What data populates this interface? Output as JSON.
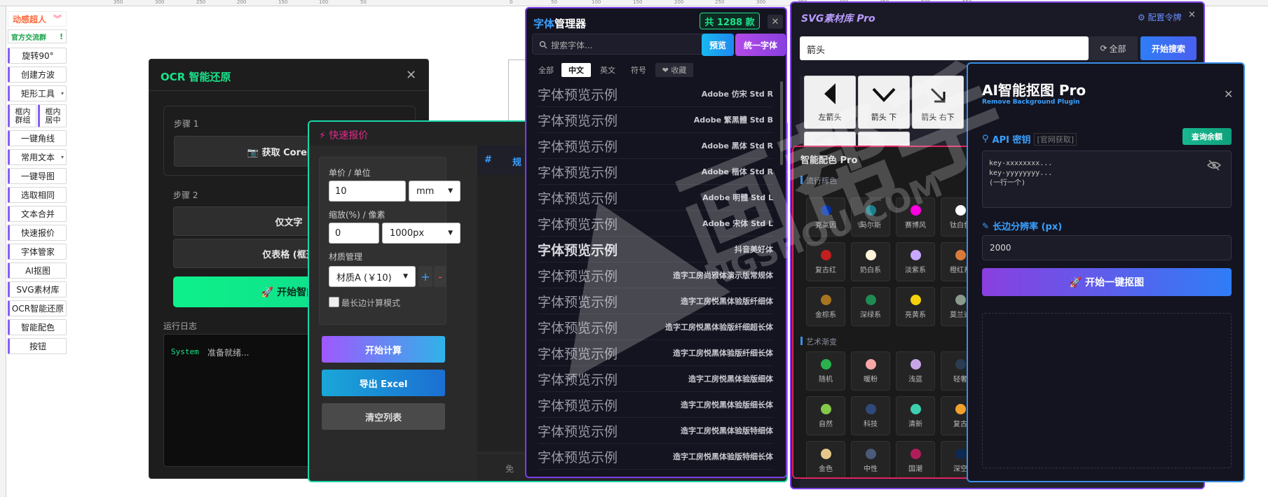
{
  "ruler": {
    "ticks": [
      "350",
      "300",
      "250",
      "200",
      "150",
      "100",
      "50",
      "0",
      "50",
      "100",
      "150",
      "200",
      "250",
      "300",
      "350",
      "400",
      "450",
      "500",
      "550"
    ]
  },
  "toolbar": {
    "brand": "动感超人",
    "brand_icon": "double-chevron-down-icon",
    "group": "官方交流群",
    "group_mark": "!",
    "items": [
      "旋转90°",
      "创建方波",
      "矩形工具",
      "一键角线",
      "常用文本",
      "一键导图",
      "选取相同",
      "文本合并",
      "快速报价",
      "字体管家",
      "AI抠图",
      "SVG素材库",
      "OCR智能还原",
      "智能配色",
      "按钮"
    ],
    "split_a": "框内群组",
    "split_b": "框内居中"
  },
  "ocr": {
    "title": "OCR 智能还原",
    "close": "✕",
    "step1": "步骤 1",
    "fetch_btn": "📷 获取 CorelDRA",
    "step2": "步骤 2",
    "text_only": "仅文字",
    "table_only": "仅表格 (框选",
    "start_btn": "🚀 开始智能",
    "log_title": "运行日志",
    "log_src": "System",
    "log_msg": "准备就绪..."
  },
  "quote": {
    "title": "⚡ 快速报价",
    "unit_label": "单价 / 单位",
    "unit_value": "10",
    "unit_sel": "mm",
    "scale_label": "缩放(%) / 像素",
    "scale_value": "0",
    "px_sel": "1000px",
    "mat_label": "材质管理",
    "mat_sel": "材质A (￥10)",
    "plus": "+",
    "minus": "-",
    "long_edge": "最长边计算模式",
    "calc_btn": "开始计算",
    "export_btn": "导出 Excel",
    "clear_btn": "清空列表",
    "col_hash": "#",
    "col_spec": "规",
    "footer": "免"
  },
  "font_manager": {
    "title_a": "字体",
    "title_b": "管理器",
    "count": "共 1288 款",
    "close": "✕",
    "search_placeholder": "搜索字体...",
    "preview_btn": "预览",
    "unify_btn": "统一字体",
    "tabs": [
      "全部",
      "中文",
      "英文",
      "符号",
      "❤ 收藏"
    ],
    "active_tab": "中文",
    "rows": [
      {
        "preview": "字体预览示例",
        "name": "Adobe 仿宋 Std R"
      },
      {
        "preview": "字体预览示例",
        "name": "Adobe 繁黑體 Std B"
      },
      {
        "preview": "字体预览示例",
        "name": "Adobe 黑体 Std R"
      },
      {
        "preview": "字体预览示例",
        "name": "Adobe 楷体 Std R"
      },
      {
        "preview": "字体预览示例",
        "name": "Adobe 明體 Std L"
      },
      {
        "preview": "字体预览示例",
        "name": "Adobe 宋体 Std L"
      },
      {
        "preview": "字体预览示例",
        "name": "抖音美好体"
      },
      {
        "preview": "字体预览示例",
        "name": "造字工房尚雅体演示版常规体"
      },
      {
        "preview": "字体预览示例",
        "name": "造字工房悦黑体验版纤细体"
      },
      {
        "preview": "字体预览示例",
        "name": "造字工房悦黑体验版纤细超长体"
      },
      {
        "preview": "字体预览示例",
        "name": "造字工房悦黑体验版纤细长体"
      },
      {
        "preview": "字体预览示例",
        "name": "造字工房悦黑体验版细体"
      },
      {
        "preview": "字体预览示例",
        "name": "造字工房悦黑体验版细长体"
      },
      {
        "preview": "字体预览示例",
        "name": "造字工房悦黑体验版特细体"
      },
      {
        "preview": "字体预览示例",
        "name": "造字工房悦黑体验版特细长体"
      }
    ]
  },
  "svg_lib": {
    "title": "SVG素材库 Pro",
    "config": "⚙ 配置令牌",
    "close": "✕",
    "search_value": "箭头",
    "scope": "全部",
    "search_btn": "开始搜索",
    "icons": [
      {
        "label": "左箭头",
        "icon": "arrow-left-icon"
      },
      {
        "label": "箭头 下",
        "icon": "chevron-down-icon"
      },
      {
        "label": "箭头 右下",
        "icon": "arrow-down-right-icon"
      }
    ]
  },
  "color": {
    "title": "智能配色 Pro",
    "sec1": "流行辉色",
    "sec2": "艺术渐变",
    "swatches1": [
      {
        "name": "克莱因",
        "color": "#002fa7"
      },
      {
        "name": "马尔斯",
        "color": "#1a7f8a"
      },
      {
        "name": "赛博风",
        "color": "#ff00e0"
      },
      {
        "name": "钛白色",
        "color": "#ffffff"
      },
      {
        "name": "复古红",
        "color": "#c0201e"
      },
      {
        "name": "奶白系",
        "color": "#fff3d9"
      },
      {
        "name": "淡紫系",
        "color": "#c9a9ff"
      },
      {
        "name": "橙红系",
        "color": "#d97b3a"
      },
      {
        "name": "金棕系",
        "color": "#a8741f"
      },
      {
        "name": "深绿系",
        "color": "#1f8c52"
      },
      {
        "name": "亮黄系",
        "color": "#f4d10b"
      },
      {
        "name": "莫兰迪",
        "color": "#8a9a8c"
      }
    ],
    "swatches2": [
      {
        "name": "随机",
        "color": "#2bb24c"
      },
      {
        "name": "暖粉",
        "color": "#f9a6a6"
      },
      {
        "name": "浅蓝",
        "color": "#c8a6e6"
      },
      {
        "name": "轻奢",
        "color": "#2a3b52"
      },
      {
        "name": "自然",
        "color": "#86c94a"
      },
      {
        "name": "科技",
        "color": "#2f4a7a"
      },
      {
        "name": "清新",
        "color": "#3fcfb0"
      },
      {
        "name": "复古",
        "color": "#f2a12b"
      },
      {
        "name": "金色",
        "color": "#e6c98a"
      },
      {
        "name": "中性",
        "color": "#4a5a7a"
      },
      {
        "name": "国潮",
        "color": "#b01e5a"
      },
      {
        "name": "深空",
        "color": "#0d2a55"
      }
    ]
  },
  "ai_cutout": {
    "title": "AI智能抠图 Pro",
    "subtitle": "Remove Background Plugin",
    "close": "✕",
    "api_label": "API 密钥",
    "api_hint": "[官网获取]",
    "balance_btn": "查询余额",
    "key_lines": "key-xxxxxxxx...\nkey-yyyyyyyy...\n(一行一个)",
    "res_label": "长边分辨率 (px)",
    "res_value": "2000",
    "start_btn": "🚀 开始一键抠图"
  },
  "watermark": {
    "brand": "画帮手",
    "url": "HUABANGSHOU.COM"
  },
  "colors": {
    "accent_green": "#19e38a",
    "accent_purple": "#7b3fe4",
    "accent_blue": "#2f7df6",
    "accent_red": "#e0245e"
  }
}
